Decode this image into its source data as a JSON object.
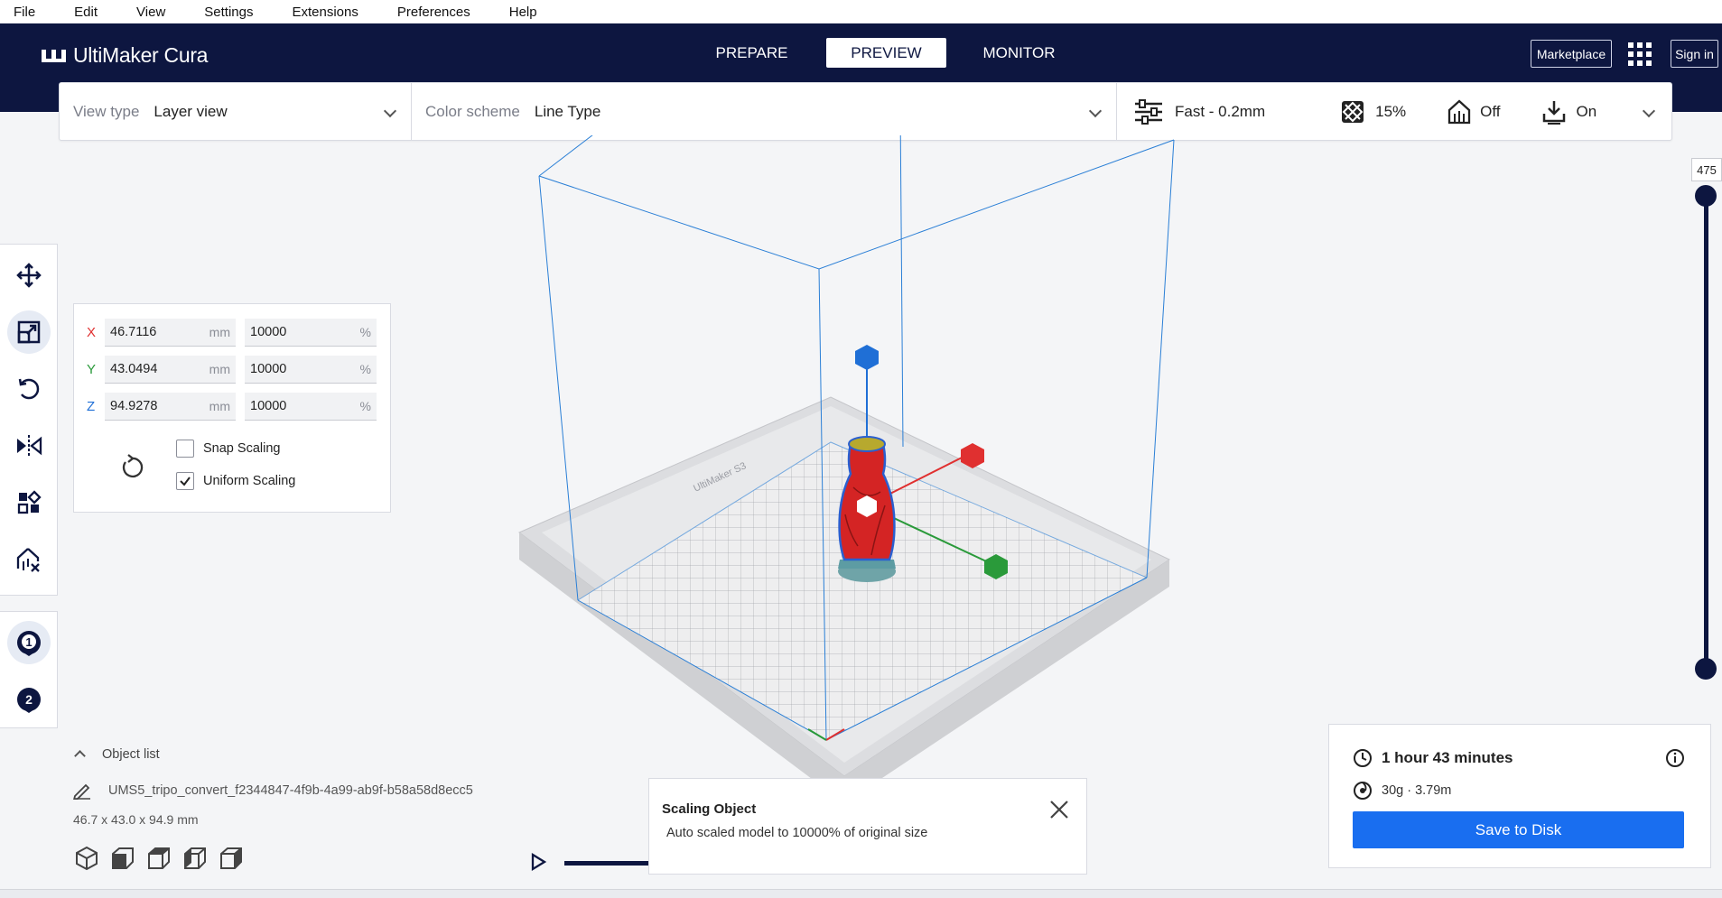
{
  "menu": [
    "File",
    "Edit",
    "View",
    "Settings",
    "Extensions",
    "Preferences",
    "Help"
  ],
  "header": {
    "logo": "UltiMaker Cura",
    "stages": [
      "PREPARE",
      "PREVIEW",
      "MONITOR"
    ],
    "active_stage": "PREVIEW",
    "marketplace": "Marketplace",
    "signin": "Sign in"
  },
  "toolbar": {
    "view_type_label": "View type",
    "view_type_value": "Layer view",
    "color_scheme_label": "Color scheme",
    "color_scheme_value": "Line Type",
    "profile": "Fast - 0.2mm",
    "infill": "15%",
    "support": "Off",
    "adhesion": "On"
  },
  "scale_panel": {
    "x": {
      "axis": "X",
      "mm": "46.7116",
      "unit_mm": "mm",
      "pct": "10000",
      "unit_pct": "%"
    },
    "y": {
      "axis": "Y",
      "mm": "43.0494",
      "unit_mm": "mm",
      "pct": "10000",
      "unit_pct": "%"
    },
    "z": {
      "axis": "Z",
      "mm": "94.9278",
      "unit_mm": "mm",
      "pct": "10000",
      "unit_pct": "%"
    },
    "snap_scaling": "Snap Scaling",
    "snap_checked": false,
    "uniform_scaling": "Uniform Scaling",
    "uniform_checked": true
  },
  "viewport": {
    "printer_label": "UltiMaker S3"
  },
  "layer_slider": {
    "max_label": "475"
  },
  "object_list": {
    "title": "Object list",
    "object_name": "UMS5_tripo_convert_f2344847-4f9b-4a99-ab9f-b58a58d8ecc5",
    "dimensions": "46.7 x 43.0 x 94.9 mm"
  },
  "message": {
    "title": "Scaling Object",
    "text": "Auto scaled model to 10000% of original size"
  },
  "print_info": {
    "time": "1 hour 43 minutes",
    "material": "30g · 3.79m",
    "save_button": "Save to Disk"
  },
  "colors": {
    "header_bg": "#0d1640",
    "accent_blue": "#196ef0",
    "axis_x": "#e03030",
    "axis_y": "#2a9a3a",
    "axis_z": "#1f6fd6"
  }
}
